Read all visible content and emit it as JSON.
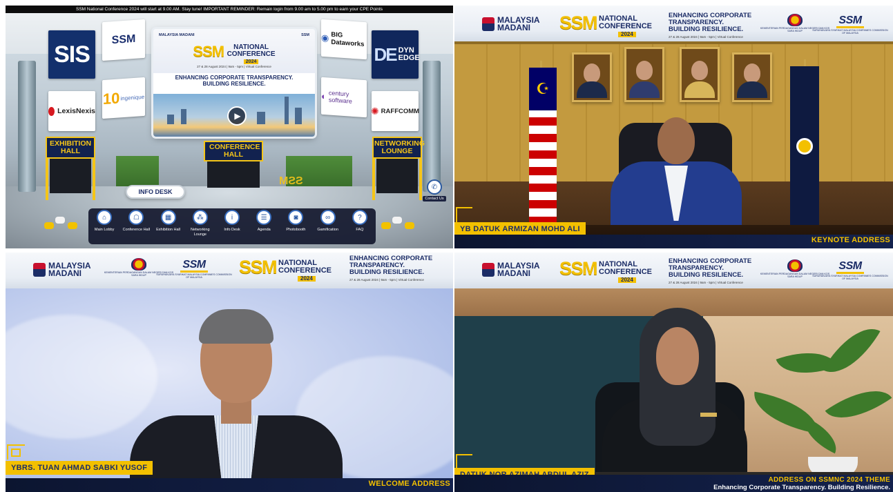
{
  "lobby": {
    "ticker": "SSM National Conference 2024 will start at 9.00 AM. Stay tune! IMPORTANT REMINDER: Remain login from 9.00 am to 5.00 pm to earn your CPE Points",
    "sponsors": {
      "sis": "SIS",
      "ssm": "SSM",
      "lexis": "LexisNexis",
      "ten": "10",
      "ingenique": "ingenique",
      "bigdataworks": "BIG Dataworks",
      "dyn": "DYN EDGE",
      "dyn_mark": "DE",
      "century": "century software",
      "raff": "RAFFCOMM"
    },
    "screen": {
      "logo_left": "MALAYSIA MADANI",
      "logo_right": "SSM",
      "ssm": "SSM",
      "title_line1": "NATIONAL",
      "title_line2": "CONFERENCE",
      "year": "2024",
      "subtitle": "27 & 28 August 2024 | 9am - 5pm | Virtual Conference",
      "theme_line1": "ENHANCING CORPORATE TRANSPARENCY.",
      "theme_line2": "BUILDING RESILIENCE."
    },
    "halls": {
      "exhibition": "EXHIBITION HALL",
      "conference": "CONFERENCE HALL",
      "networking": "NETWORKING LOUNGE"
    },
    "info_desk": "INFO DESK",
    "floor_logo": "SSM",
    "contact": "Contact Us",
    "nav": [
      {
        "label": "Main Lobby",
        "icon": "home-icon"
      },
      {
        "label": "Conference Hall",
        "icon": "conference-icon"
      },
      {
        "label": "Exhibition Hall",
        "icon": "exhibition-icon"
      },
      {
        "label": "Networking Lounge",
        "icon": "network-icon"
      },
      {
        "label": "Info Desk",
        "icon": "info-icon"
      },
      {
        "label": "Agenda",
        "icon": "agenda-icon"
      },
      {
        "label": "Photobooth",
        "icon": "camera-icon"
      },
      {
        "label": "Gamification",
        "icon": "game-icon"
      },
      {
        "label": "FAQ",
        "icon": "faq-icon"
      }
    ]
  },
  "banner": {
    "madani_line1": "MALAYSIA",
    "madani_line2": "MADANI",
    "ssm": "SSM",
    "title_line1": "NATIONAL",
    "title_line2": "CONFERENCE",
    "year": "2024",
    "theme_line1": "ENHANCING CORPORATE",
    "theme_line2": "TRANSPARENCY.",
    "theme_line3": "BUILDING RESILIENCE.",
    "date": "27 & 28 August 2024  |  9am - 5pm  |  Virtual Conference",
    "ministry": "KEMENTERIAN PERDAGANGAN DALAM NEGERI DAN KOS SARA HIDUP",
    "ssm_logo": "SSM",
    "ssm_org": "SURUHANJAYA SYARIKAT MALAYSIA COMPANIES COMMISSION OF MALAYSIA"
  },
  "keynote": {
    "speaker": "YB DATUK ARMIZAN MOHD ALI",
    "caption": "KEYNOTE ADDRESS"
  },
  "welcome": {
    "speaker": "YBRS. TUAN AHMAD SABKI YUSOF",
    "caption": "WELCOME ADDRESS"
  },
  "theme": {
    "speaker": "DATUK NOR AZIMAH ABDUL AZIZ",
    "caption": "ADDRESS ON SSMNC 2024 THEME",
    "subcaption": "Enhancing Corporate Transparency. Building Resilience."
  },
  "colors": {
    "brand_yellow": "#f3c000",
    "brand_navy": "#1b2c66",
    "caption_bar": "#0c1530"
  }
}
